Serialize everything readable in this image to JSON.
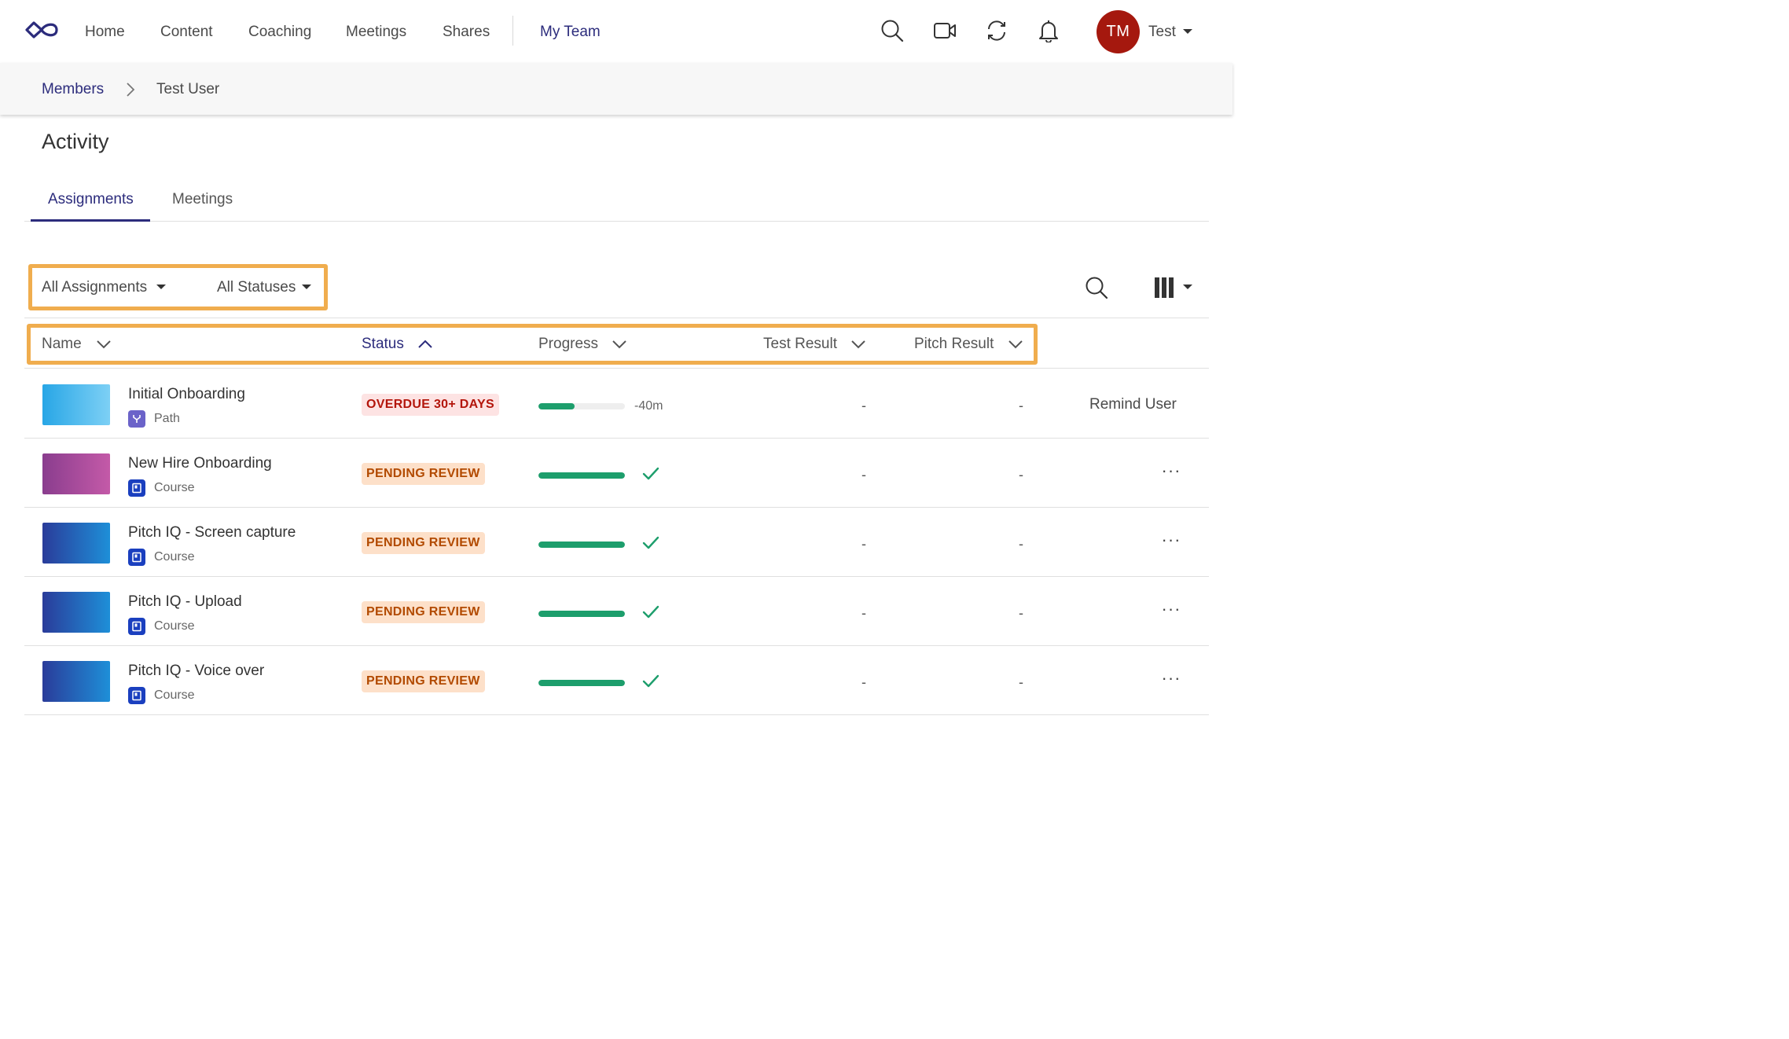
{
  "nav": {
    "items": [
      "Home",
      "Content",
      "Coaching",
      "Meetings",
      "Shares",
      "My Team"
    ],
    "active": "My Team",
    "icons": [
      "search-icon",
      "video-icon",
      "sync-icon",
      "bell-icon"
    ],
    "user_initials": "TM",
    "user_name": "Test",
    "avatar_color": "#a5180e"
  },
  "breadcrumb": {
    "parent": "Members",
    "current": "Test User"
  },
  "page": {
    "title": "Activity"
  },
  "tabs": {
    "items": [
      "Assignments",
      "Meetings"
    ],
    "active": "Assignments"
  },
  "filters": {
    "assignment": "All Assignments",
    "status": "All Statuses"
  },
  "table": {
    "headers": {
      "name": "Name",
      "status": "Status",
      "progress": "Progress",
      "test_result": "Test Result",
      "pitch_result": "Pitch Result"
    },
    "sorted_by": "Status",
    "rows": [
      {
        "name": "Initial Onboarding",
        "type": "Path",
        "status": "OVERDUE 30+ DAYS",
        "progress_fraction": 0.42,
        "progress_text": "-40m",
        "complete": false,
        "test_result": "-",
        "pitch_result": "-",
        "action": "Remind User"
      },
      {
        "name": "New Hire Onboarding",
        "type": "Course",
        "status": "PENDING REVIEW",
        "progress_fraction": 1,
        "complete": true,
        "test_result": "-",
        "pitch_result": "-",
        "action": "···"
      },
      {
        "name": "Pitch IQ - Screen capture",
        "type": "Course",
        "status": "PENDING REVIEW",
        "progress_fraction": 1,
        "complete": true,
        "test_result": "-",
        "pitch_result": "-",
        "action": "···"
      },
      {
        "name": "Pitch IQ - Upload",
        "type": "Course",
        "status": "PENDING REVIEW",
        "progress_fraction": 1,
        "complete": true,
        "test_result": "-",
        "pitch_result": "-",
        "action": "···"
      },
      {
        "name": "Pitch IQ - Voice over",
        "type": "Course",
        "status": "PENDING REVIEW",
        "progress_fraction": 1,
        "complete": true,
        "test_result": "-",
        "pitch_result": "-",
        "action": "···"
      }
    ]
  },
  "colors": {
    "accent": "#2c2c7c",
    "highlight": "#f0ad4e",
    "progress": "#1d9e6c",
    "overdue": "#b3150b",
    "pending": "#b24a00"
  }
}
